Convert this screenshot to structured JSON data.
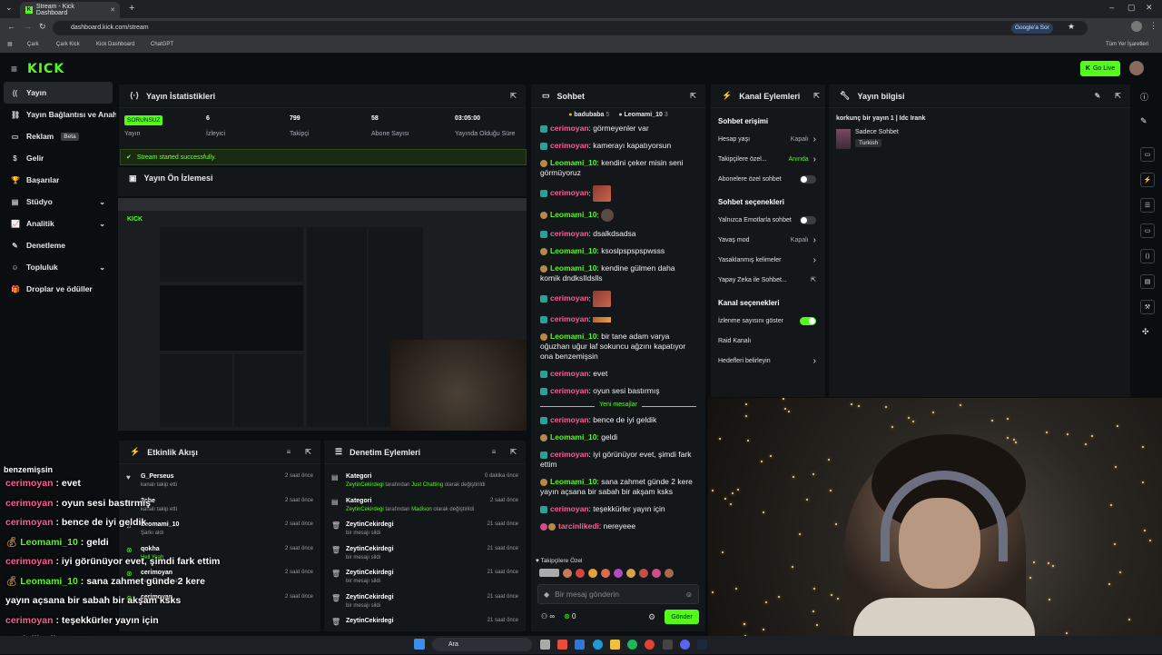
{
  "browser": {
    "tab_title": "Stream - Kick Dashboard",
    "url": "dashboard.kick.com/stream",
    "bookmarks": [
      "Çark",
      "Çark Kick",
      "Kick Dashboard",
      "ChatGPT"
    ],
    "bookmarks_right": "Tüm Yer İşaretleri",
    "google_label": "Google'a Sor"
  },
  "header": {
    "logo": "KICK",
    "go_live": "Go Live"
  },
  "sidebar": {
    "items": [
      {
        "label": "Yayın",
        "icon": "broadcast-icon",
        "active": true
      },
      {
        "label": "Yayın Bağlantısı ve Anahtarı",
        "icon": "link-icon"
      },
      {
        "label": "Reklam",
        "icon": "ad-icon",
        "badge": "Beta"
      },
      {
        "label": "Gelir",
        "icon": "revenue-icon"
      },
      {
        "label": "Başarılar",
        "icon": "trophy-icon"
      },
      {
        "label": "Stüdyo",
        "icon": "studio-icon",
        "chevron": true
      },
      {
        "label": "Analitik",
        "icon": "analytics-icon",
        "chevron": true
      },
      {
        "label": "Denetleme",
        "icon": "moderation-icon"
      },
      {
        "label": "Topluluk",
        "icon": "community-icon",
        "chevron": true
      },
      {
        "label": "Droplar ve ödüller",
        "icon": "gift-icon"
      }
    ]
  },
  "stats": {
    "title": "Yayın İstatistikleri",
    "status_badge": "SORUNSUZ",
    "status_label": "Yayın",
    "viewers": "6",
    "viewers_label": "İzleyici",
    "followers": "799",
    "followers_label": "Takipçi",
    "subs": "58",
    "subs_label": "Abone Sayısı",
    "duration": "03:05:00",
    "duration_label": "Yayında Olduğu Süre",
    "success_msg": "Stream started successfully."
  },
  "preview": {
    "title": "Yayın Ön İzlemesi"
  },
  "chat": {
    "title": "Sohbet",
    "top_users": [
      {
        "name": "badubaba",
        "count": "5"
      },
      {
        "name": "Leomami_10",
        "count": "3"
      }
    ],
    "messages": [
      {
        "user": "cerimoyan",
        "text": "görmeyenler var",
        "type": "c"
      },
      {
        "user": "cerimoyan",
        "text": "kamerayı kapatıyorsun",
        "type": "c"
      },
      {
        "user": "Leomami_10",
        "text": "kendini çeker misin seni görmüyoruz",
        "type": "l"
      },
      {
        "user": "cerimoyan",
        "text": "",
        "type": "c",
        "emote": "emote1"
      },
      {
        "user": "Leomami_10",
        "text": "",
        "type": "l",
        "emote": "emote-face"
      },
      {
        "user": "cerimoyan",
        "text": "dsalkdsadsa",
        "type": "c"
      },
      {
        "user": "Leomami_10",
        "text": "ksoslpspspspwsss",
        "type": "l"
      },
      {
        "user": "Leomami_10",
        "text": "kendine gülmen daha komik dndksIldslls",
        "type": "l"
      },
      {
        "user": "cerimoyan",
        "text": "",
        "type": "c",
        "emote": "emote1"
      },
      {
        "user": "cerimoyan",
        "text": "",
        "type": "c",
        "emote": "emote2"
      },
      {
        "user": "Leomami_10",
        "text": "bir tane adam varya oğuzhan uğur laf sokuncu ağzını kapatıyor ona benzemişsin",
        "type": "l"
      },
      {
        "user": "cerimoyan",
        "text": "evet",
        "type": "c"
      },
      {
        "user": "cerimoyan",
        "text": "oyun sesi bastırmış",
        "type": "c"
      }
    ],
    "new_messages_label": "Yeni mesajlar",
    "messages_new": [
      {
        "user": "cerimoyan",
        "text": "bence de iyi geldik",
        "type": "c"
      },
      {
        "user": "Leomami_10",
        "text": "geldi",
        "type": "l"
      },
      {
        "user": "cerimoyan",
        "text": "iyi görünüyor evet, şimdi fark ettim",
        "type": "c"
      },
      {
        "user": "Leomami_10",
        "text": "sana zahmet günde 2 kere yayın açsana bir sabah bir akşam ksks",
        "type": "l"
      },
      {
        "user": "cerimoyan",
        "text": "teşekkürler yayın için",
        "type": "c"
      },
      {
        "user": "tarcinlikedi",
        "text": "nereyeee",
        "type": "t"
      }
    ],
    "followers_only": "Takipçilere Özel",
    "input_placeholder": "Bir mesaj gönderin",
    "send": "Gönder",
    "infinity": "∞",
    "points": "0"
  },
  "channel_actions": {
    "title": "Kanal Eylemleri",
    "chat_access": "Sohbet erişimi",
    "rows1": [
      {
        "label": "Hesap yaşı",
        "value": "Kapalı",
        "chev": true
      },
      {
        "label": "Takipçilere özel...",
        "value": "Anında",
        "chev": true,
        "green": true
      },
      {
        "label": "Abonelere özel sohbet",
        "toggle": false
      }
    ],
    "chat_options": "Sohbet seçenekleri",
    "rows2": [
      {
        "label": "Yalnızca Emotlarla sohbet",
        "toggle": false
      },
      {
        "label": "Yavaş mod",
        "value": "Kapalı",
        "chev": true
      },
      {
        "label": "Yasaklanmış kelimeler",
        "chev": true
      },
      {
        "label": "Yapay Zeka ile Sohbet...",
        "ext": true
      }
    ],
    "channel_options": "Kanal seçenekleri",
    "rows3": [
      {
        "label": "İzlenme sayısını göster",
        "toggle": true
      },
      {
        "label": "Raid Kanalı"
      },
      {
        "label": "Hedefleri belirleyin",
        "chev": true
      }
    ]
  },
  "stream_info": {
    "title": "Yayın bilgisi",
    "stream_title": "korkunç bir yayın 1 | Idc Irank",
    "category": "Sadece Sohbet",
    "tag": "Turkish"
  },
  "activity": {
    "title": "Etkinlik Akışı",
    "items": [
      {
        "name": "G_Perseus",
        "sub": "kanalı takip etti",
        "time": "2 saat önce",
        "icon": "heart-icon"
      },
      {
        "name": "2che",
        "sub": "kanalı takip etti",
        "time": "2 saat önce",
        "icon": "heart-icon"
      },
      {
        "name": "Leomami_10",
        "sub": "Şarkı aldı",
        "time": "2 saat önce",
        "icon": "music-icon"
      },
      {
        "name": "qokha",
        "sub": "Hell Yeah",
        "time": "2 saat önce",
        "icon": "points-icon"
      },
      {
        "name": "cerimoyan",
        "sub": "Sahne Odağı aldı",
        "time": "2 saat önce",
        "icon": "points-icon"
      },
      {
        "name": "cerimoyan",
        "sub": "",
        "time": "2 saat önce",
        "icon": "points-icon"
      }
    ]
  },
  "moderation": {
    "title": "Denetim Eylemleri",
    "items": [
      {
        "name": "Kategori",
        "sub_user": "ZeytinCekirdegi",
        "sub_mid": "tarafından",
        "sub_from": "Just Chatting",
        "sub_end": "olarak değiştirildi",
        "time": "0 dakika önce",
        "icon": "category-icon"
      },
      {
        "name": "Kategori",
        "sub_user": "ZeytinCekirdegi",
        "sub_mid": "tarafından",
        "sub_from": "Madison",
        "sub_end": "olarak değiştirildi",
        "time": "2 saat önce",
        "icon": "category-icon"
      },
      {
        "name": "ZeytinCekirdegi",
        "sub": "bir mesajı sildi",
        "time": "21 saat önce",
        "icon": "trash-icon"
      },
      {
        "name": "ZeytinCekirdegi",
        "sub": "bir mesajı sildi",
        "time": "21 saat önce",
        "icon": "trash-icon"
      },
      {
        "name": "ZeytinCekirdegi",
        "sub": "bir mesajı sildi",
        "time": "21 saat önce",
        "icon": "trash-icon"
      },
      {
        "name": "ZeytinCekirdegi",
        "sub": "bir mesajı sildi",
        "time": "21 saat önce",
        "icon": "trash-icon"
      },
      {
        "name": "ZeytinCekirdegi",
        "sub": "",
        "time": "21 saat önce",
        "icon": "trash-icon"
      }
    ]
  },
  "overlay_chat": [
    {
      "user": "",
      "text": "benzemişsin",
      "type": "c",
      "partial": true
    },
    {
      "user": "cerimoyan",
      "text": "evet",
      "type": "c"
    },
    {
      "user": "cerimoyan",
      "text": "oyun sesi bastırmış",
      "type": "c"
    },
    {
      "user": "cerimoyan",
      "text": "bence de iyi geldik",
      "type": "c"
    },
    {
      "user": "Leomami_10",
      "text": "geldi",
      "type": "l"
    },
    {
      "user": "cerimoyan",
      "text": "iyi görünüyor evet, şimdi fark ettim",
      "type": "c"
    },
    {
      "user": "Leomami_10",
      "text": "sana zahmet günde 2 kere",
      "type": "l"
    },
    {
      "user": "",
      "text": "yayın açsana bir sabah bir akşam ksks",
      "type": "c"
    },
    {
      "user": "cerimoyan",
      "text": "teşekkürler yayın için",
      "type": "c"
    },
    {
      "user": "tarcinlikedi",
      "text": "nereyeee",
      "type": "t"
    }
  ],
  "taskbar": {
    "search": "Ara"
  },
  "colors": {
    "accent": "#53fc18",
    "cerimoyan": "#ff5c93",
    "leomami": "#53fc18",
    "panel": "#14171a",
    "bg": "#0b0e10"
  }
}
